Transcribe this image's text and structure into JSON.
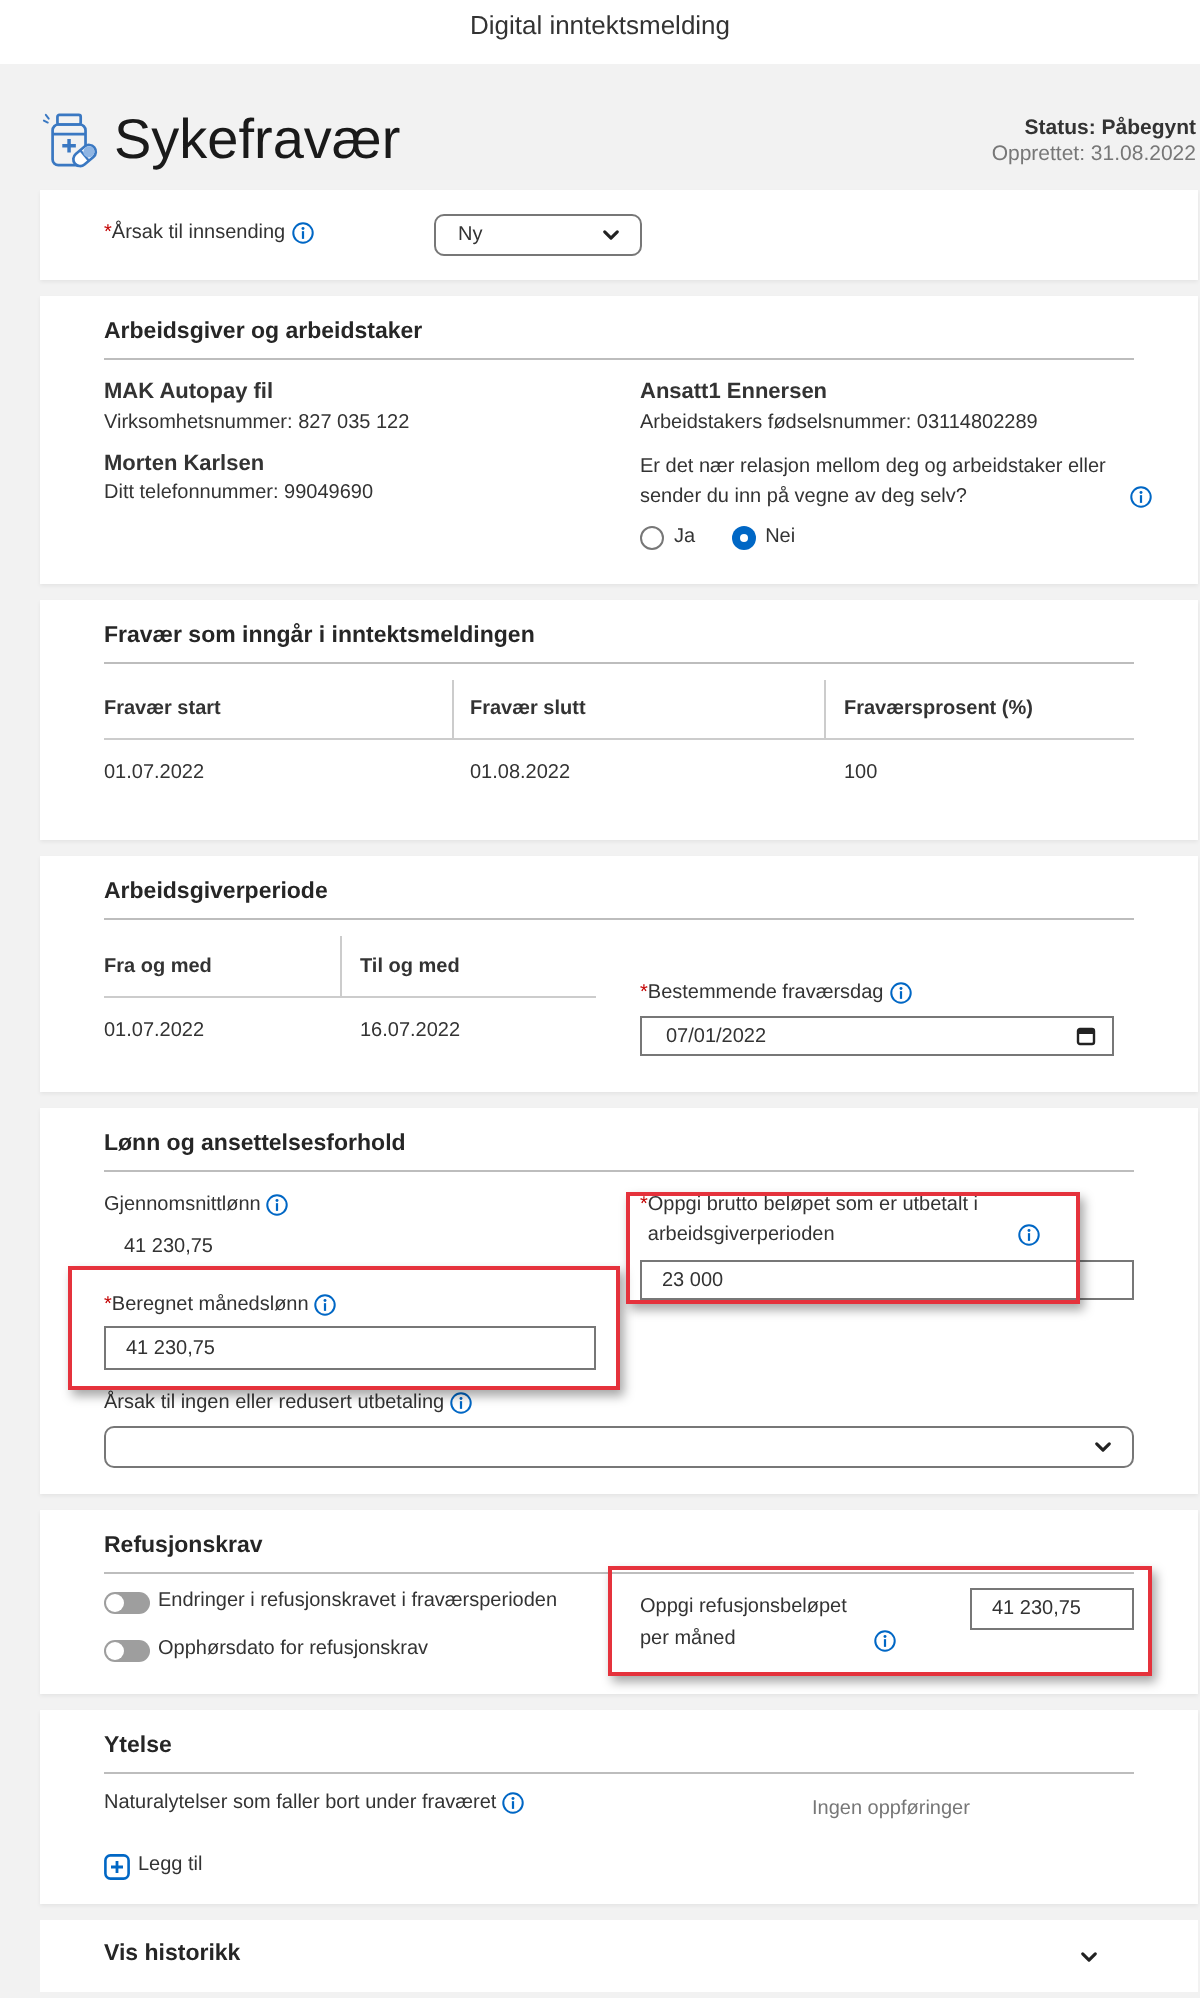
{
  "app_bar": {
    "title": "Digital inntektsmelding"
  },
  "page_header": {
    "title": "Sykefravær",
    "status": "Status: Påbegynt",
    "created": "Opprettet: 31.08.2022"
  },
  "submission": {
    "label": "Årsak til innsending",
    "required_mark": "*",
    "info": true,
    "value": "Ny"
  },
  "parties": {
    "title": "Arbeidsgiver og arbeidstaker",
    "employer": {
      "name": "MAK Autopay fil",
      "org_number": "Virksomhetsnummer: 827 035 122",
      "contact": "Morten Karlsen",
      "phone": "Ditt telefonnummer: 99049690"
    },
    "employee": {
      "name": "Ansatt1 Ennersen",
      "id_number": "Arbeidstakers fødselsnummer: 03114802289"
    },
    "relation_question": {
      "label": "Er det nær relasjon mellom deg og arbeidstaker eller sender du inn på vegne av deg selv?",
      "info": true,
      "options": [
        {
          "label": "Ja",
          "selected": false
        },
        {
          "label": "Nei",
          "selected": true
        }
      ]
    }
  },
  "absence": {
    "title": "Fravær som inngår i inntektsmeldingen",
    "table": {
      "columns": [
        "Fravær start",
        "Fravær slutt",
        "Fraværsprosent (%)"
      ],
      "rows": [
        [
          "01.07.2022",
          "01.08.2022",
          "100"
        ]
      ]
    }
  },
  "employer_period": {
    "title": "Arbeidsgiverperiode",
    "table": {
      "columns": [
        "Fra og med",
        "Til og med"
      ],
      "rows": [
        [
          "01.07.2022",
          "16.07.2022"
        ]
      ]
    },
    "decisive_day": {
      "label": "Bestemmende fraværsdag",
      "required_mark": "*",
      "info": true,
      "value": "07/01/2022"
    }
  },
  "salary": {
    "title": "Lønn og ansettelsesforhold",
    "average": {
      "label": "Gjennomsnittlønn",
      "info": true,
      "value": "41 230,75"
    },
    "gross": {
      "label": "Oppgi brutto beløpet som er utbetalt i arbeidsgiverperioden",
      "required_mark": "*",
      "info": true,
      "value": "23 000",
      "highlighted": true
    },
    "monthly": {
      "label": "Beregnet månedslønn",
      "required_mark": "*",
      "info": true,
      "value": "41 230,75",
      "highlighted": true
    },
    "reduction_reason": {
      "label": "Årsak til ingen eller redusert utbetaling",
      "info": true
    }
  },
  "refund": {
    "title": "Refusjonskrav",
    "toggles": [
      {
        "label": "Endringer i refusjonskravet i fraværsperioden",
        "on": false
      },
      {
        "label": "Opphørsdato for refusjonskrav",
        "on": false
      }
    ],
    "amount": {
      "label": "Oppgi refusjonsbeløpet per måned",
      "info": true,
      "value": "41 230,75",
      "highlighted": true
    }
  },
  "benefits": {
    "title": "Ytelse",
    "label": "Naturalytelser som faller bort under fraværet",
    "info": true,
    "empty_text": "Ingen oppføringer",
    "add_button": "Legg til"
  },
  "history": {
    "title": "Vis historikk",
    "expanded": false
  }
}
